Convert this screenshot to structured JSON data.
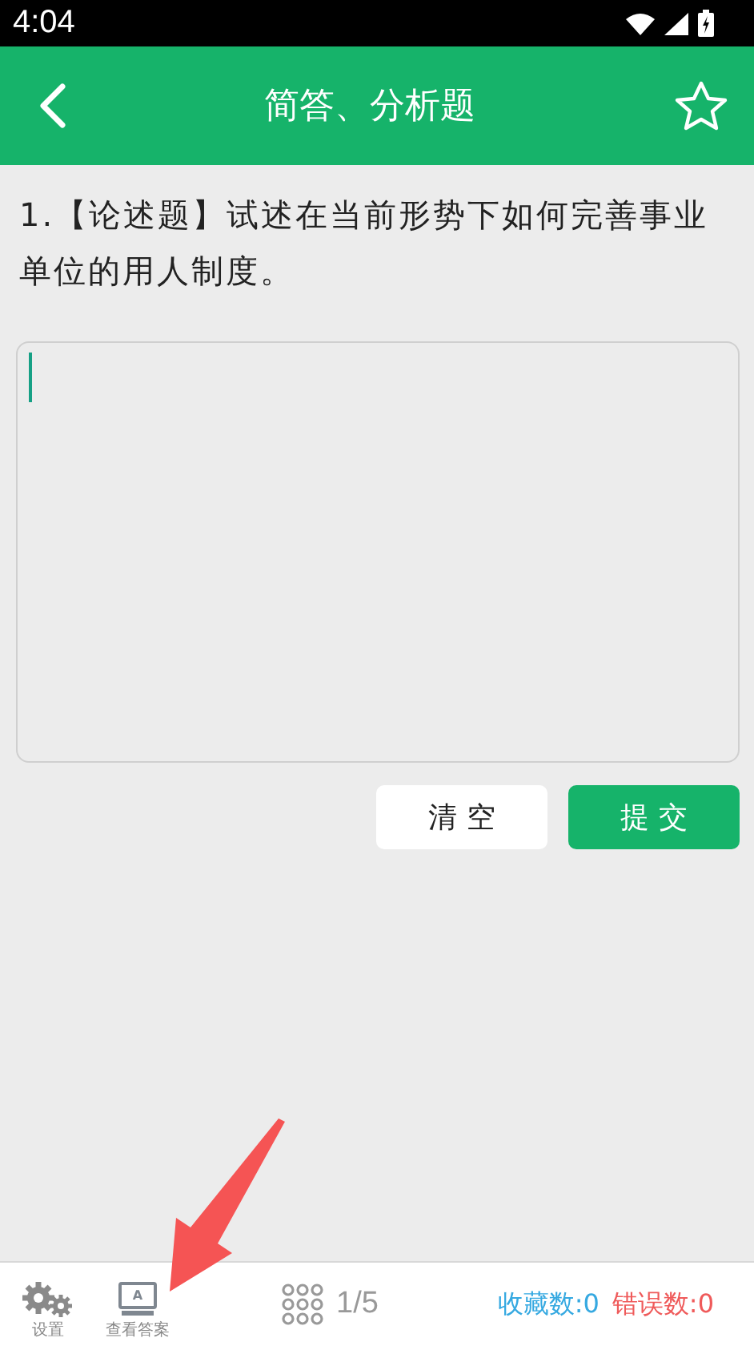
{
  "status_bar": {
    "time": "4:04"
  },
  "header": {
    "title": "简答、分析题",
    "favorited": false
  },
  "question": {
    "text": "1.【论述题】试述在当前形势下如何完善事业单位的用人制度。"
  },
  "answer": {
    "focused": true
  },
  "buttons": [
    {
      "label": "清 空",
      "kind": "secondary"
    },
    {
      "label": "提 交",
      "kind": "primary"
    }
  ],
  "bottom_bar": {
    "settings_label": "设置",
    "answer_label": "查看答案",
    "answer_icon_letter": "A",
    "progress": "1/5",
    "favorites": "收藏数:0",
    "errors": "错误数:0"
  }
}
